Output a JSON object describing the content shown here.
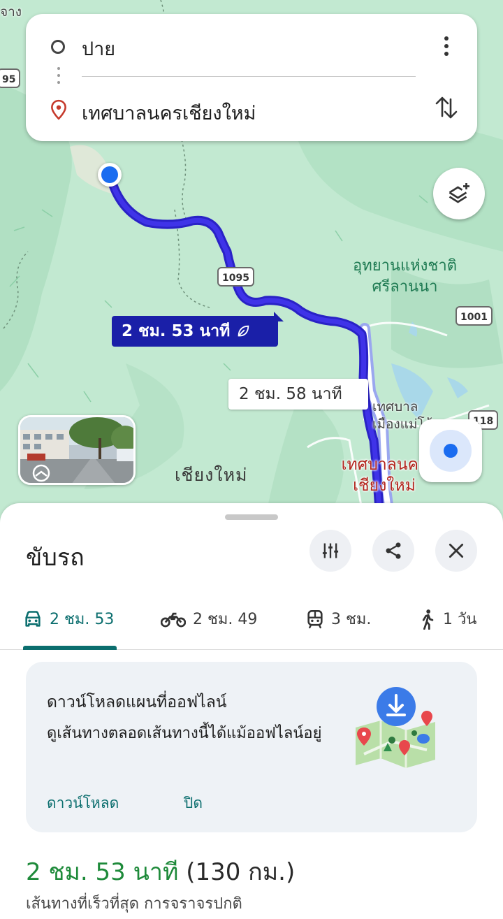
{
  "search": {
    "origin": "ปาย",
    "destination": "เทศบาลนครเชียงใหม่"
  },
  "map": {
    "corner_label_top": "จาง",
    "route_signs": [
      "95",
      "1095",
      "1001",
      "118"
    ],
    "park_label_line1": "อุทยานแห่งชาติ",
    "park_label_line2": "ศรีลานนา",
    "district_label_line1": "เทศบาล",
    "district_label_line2": "เมืองแม่โจ้",
    "province_label": "เชียงใหม่",
    "dest_label_line1": "เทศบาลนคร",
    "dest_label_line2": "เชียงใหม่",
    "primary_route_time": "2 ชม. 53 นาที",
    "alt_route_time": "2 ชม. 58 นาที"
  },
  "sheet": {
    "title": "ขับรถ",
    "modes": [
      {
        "icon": "car-icon",
        "label": "2 ชม. 53",
        "active": true
      },
      {
        "icon": "motorcycle-icon",
        "label": "2 ชม. 49",
        "active": false
      },
      {
        "icon": "train-icon",
        "label": "3 ชม.",
        "active": false
      },
      {
        "icon": "walk-icon",
        "label": "1 วัน",
        "active": false
      }
    ],
    "offline": {
      "title": "ดาวน์โหลดแผนที่ออฟไลน์",
      "description": "ดูเส้นทางตลอดเส้นทางนี้ได้แม้ออฟไลน์อยู่",
      "download_label": "ดาวน์โหลด",
      "close_label": "ปิด"
    },
    "eta": {
      "time": "2 ชม. 53 นาที",
      "distance": "(130 กม.)",
      "subtitle": "เส้นทางที่เร็วที่สุด การจราจรปกติ"
    }
  },
  "colors": {
    "route_primary": "#1a1fa8",
    "accent": "#0b6e6e",
    "eta_green": "#1e8a3a",
    "dest_red": "#b3261e",
    "map_green": "#bfe8cf"
  }
}
